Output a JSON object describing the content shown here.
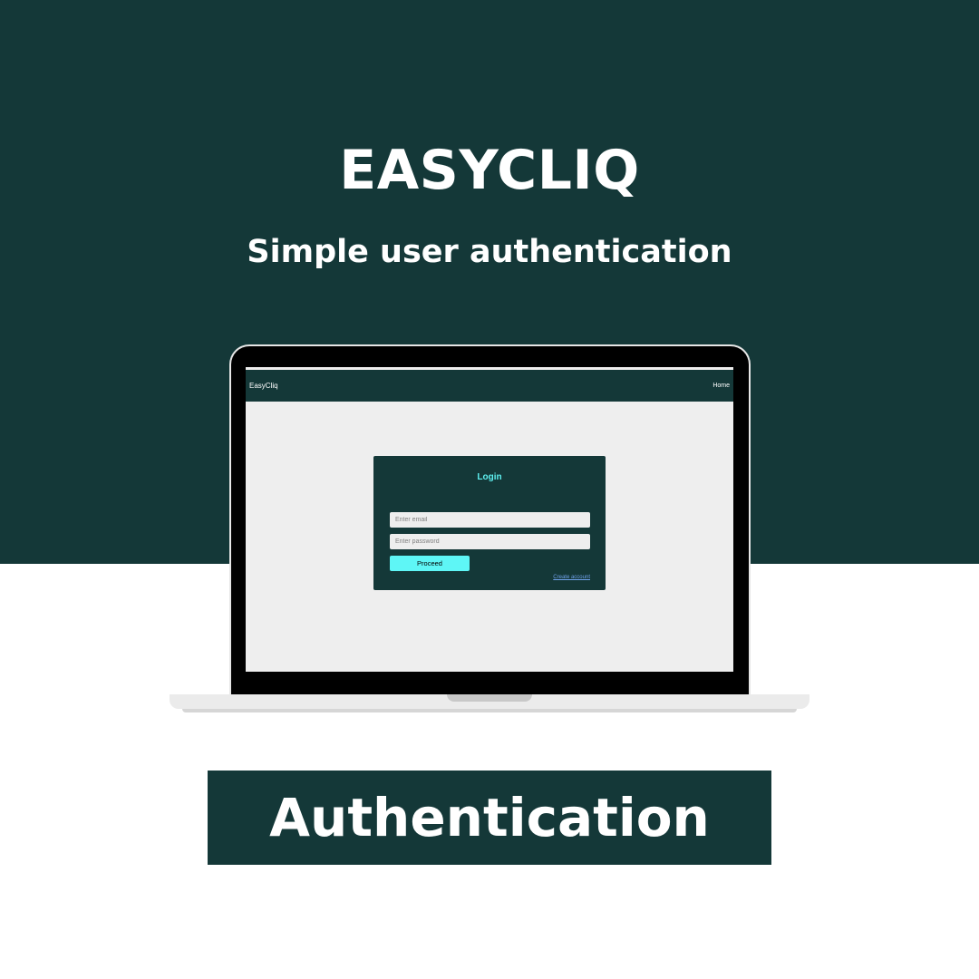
{
  "hero": {
    "title": "EASYCLIQ",
    "subtitle": "Simple user authentication"
  },
  "app": {
    "nav": {
      "brand": "EasyCliq",
      "home_link": "Home"
    },
    "login": {
      "title": "Login",
      "email_placeholder": "Enter email",
      "password_placeholder": "Enter password",
      "proceed_label": "Proceed",
      "create_account_label": "Create account"
    }
  },
  "footer": {
    "label": "Authentication"
  },
  "colors": {
    "primary_dark": "#143838",
    "accent_cyan": "#5ef6f6",
    "screen_bg": "#eeeeee",
    "link_blue": "#6fa0e8"
  }
}
